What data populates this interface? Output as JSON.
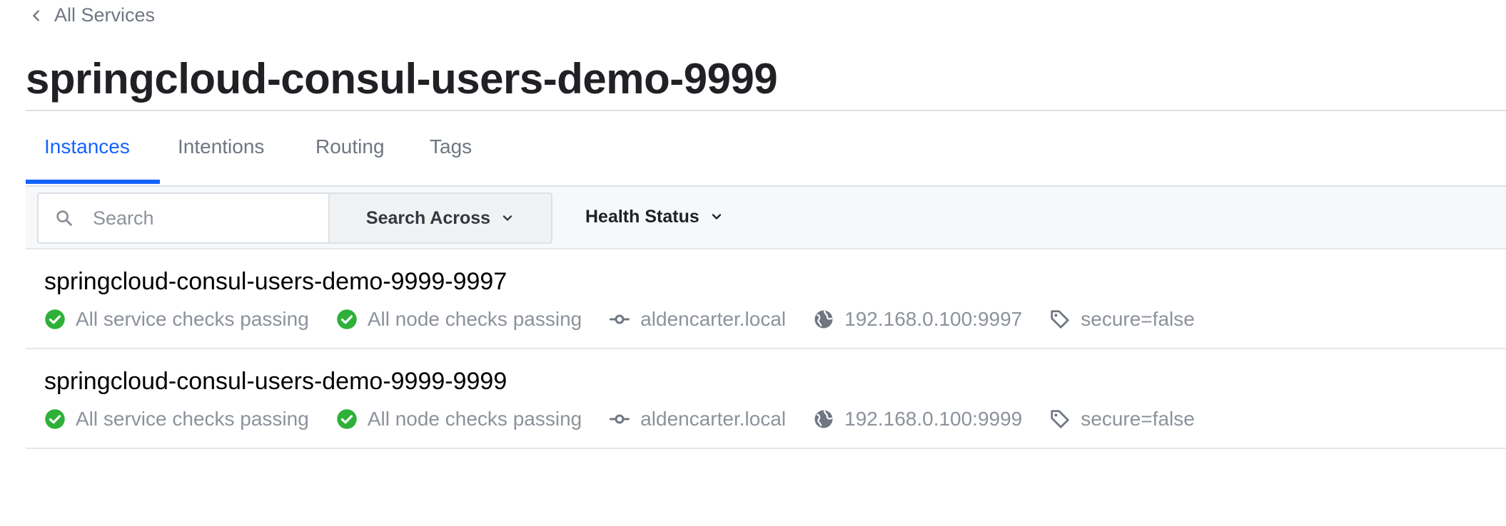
{
  "breadcrumb": {
    "label": "All Services"
  },
  "page": {
    "title": "springcloud-consul-users-demo-9999"
  },
  "tabs": [
    {
      "label": "Instances",
      "active": true
    },
    {
      "label": "Intentions",
      "active": false
    },
    {
      "label": "Routing",
      "active": false
    },
    {
      "label": "Tags",
      "active": false
    }
  ],
  "filters": {
    "search_value": "",
    "search_placeholder": "Search",
    "search_across_label": "Search Across",
    "health_status_label": "Health Status"
  },
  "instances": [
    {
      "name": "springcloud-consul-users-demo-9999-9997",
      "service_checks": "All service checks passing",
      "node_checks": "All node checks passing",
      "node": "aldencarter.local",
      "address": "192.168.0.100:9997",
      "tag": "secure=false"
    },
    {
      "name": "springcloud-consul-users-demo-9999-9999",
      "service_checks": "All service checks passing",
      "node_checks": "All node checks passing",
      "node": "aldencarter.local",
      "address": "192.168.0.100:9999",
      "tag": "secure=false"
    }
  ],
  "colors": {
    "accent": "#1563ff",
    "passing": "#2eb039",
    "muted_text": "#8c929b",
    "icon_gray": "#6f7682"
  }
}
